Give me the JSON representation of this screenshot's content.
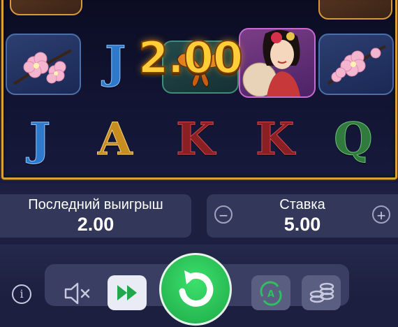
{
  "win_popup": {
    "amount": "2.00"
  },
  "reels": {
    "row_letters": [
      "J",
      "A",
      "K",
      "K",
      "Q"
    ],
    "middle_letter": "J"
  },
  "last_win": {
    "label": "Последний выигрыш",
    "value": "2.00"
  },
  "bet": {
    "label": "Ставка",
    "value": "5.00",
    "decrease_symbol": "−",
    "increase_symbol": "+"
  },
  "controls": {
    "info_symbol": "i",
    "mute_icon": "speaker-muted-icon",
    "turbo_icon": "fast-forward-icon",
    "spin_icon": "spin-arrow-icon",
    "autoplay_letter": "A",
    "coins_icon": "coin-stack-icon"
  },
  "colors": {
    "frame_gold": "#d9a233",
    "win_gold": "#ffcd38",
    "spin_green": "#27c45a",
    "panel_bg": "#333759"
  }
}
